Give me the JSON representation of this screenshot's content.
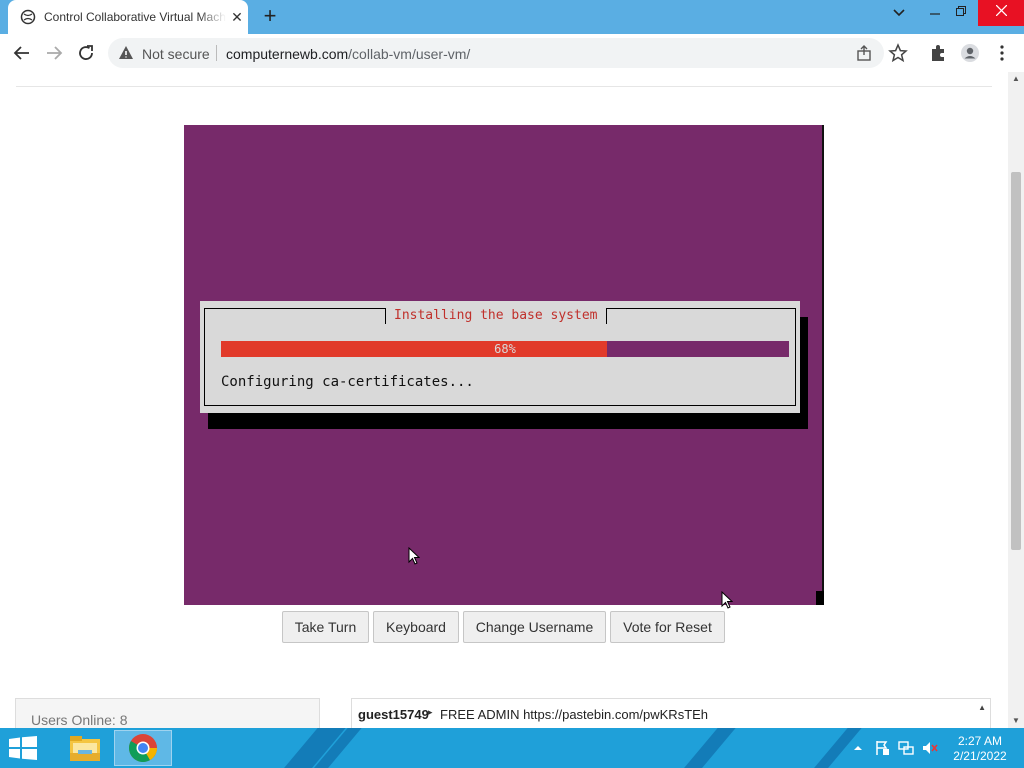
{
  "browser": {
    "tab_title": "Control Collaborative Virtual Machine",
    "tab_close": "✕",
    "new_tab": "+",
    "security_label": "Not secure",
    "url_host": "computernewb.com",
    "url_path": "/collab-vm/user-vm/"
  },
  "vm_screen": {
    "dialog_title": "Installing the base system",
    "progress_percent": 68,
    "progress_label": "68%",
    "status_message": "Configuring ca-certificates..."
  },
  "controls": {
    "take_turn": "Take Turn",
    "keyboard": "Keyboard",
    "change_username": "Change Username",
    "vote_reset": "Vote for Reset"
  },
  "users": {
    "online_text": "Users Online: 8"
  },
  "chat": {
    "username": "guest15749",
    "message": "FREE ADMIN https://pastebin.com/pwKRsTEh"
  },
  "taskbar": {
    "time": "2:27 AM",
    "date": "2/21/2022",
    "accent": "#1fa0d9"
  },
  "icons": [
    "globe-icon",
    "back-arrow-icon",
    "forward-arrow-icon",
    "reload-icon",
    "warning-icon",
    "share-icon",
    "star-icon",
    "puzzle-icon",
    "profile-icon",
    "kebab-menu-icon",
    "windows-start-icon",
    "file-explorer-icon",
    "chrome-icon",
    "tray-up-arrow-icon",
    "flag-icon",
    "network-icon",
    "speaker-muted-icon"
  ]
}
